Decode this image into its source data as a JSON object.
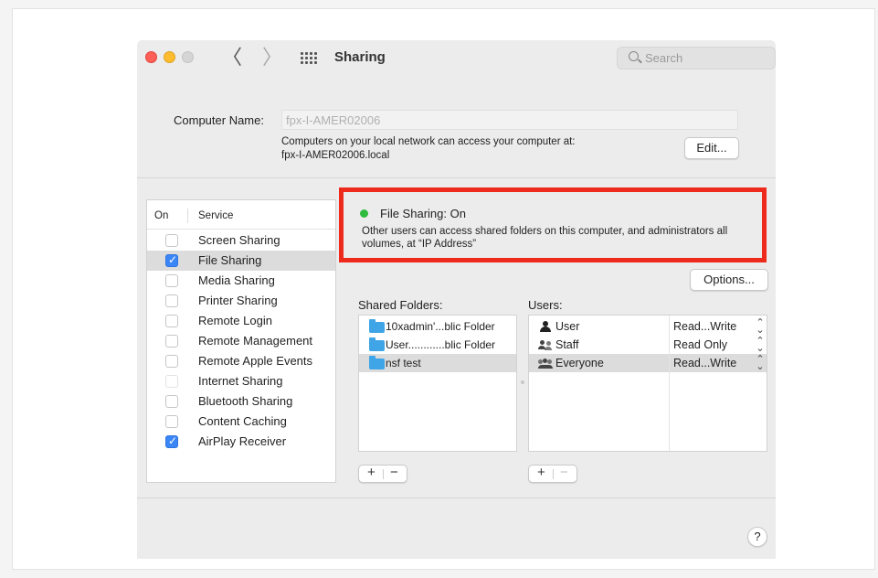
{
  "window": {
    "title": "Sharing",
    "back_label": "〈",
    "forward_label": "〉",
    "search_placeholder": "Search"
  },
  "computer_name": {
    "label": "Computer Name:",
    "value": "fpx-I-AMER02006",
    "info_line1": "Computers on your local network can access your computer at:",
    "info_line2": "fpx-I-AMER02006.local",
    "edit_label": "Edit..."
  },
  "services": {
    "header_on": "On",
    "header_service": "Service",
    "items": [
      {
        "label": "Screen Sharing",
        "checked": false
      },
      {
        "label": "File Sharing",
        "checked": true,
        "selected": true
      },
      {
        "label": "Media Sharing",
        "checked": false
      },
      {
        "label": "Printer Sharing",
        "checked": false
      },
      {
        "label": "Remote Login",
        "checked": false
      },
      {
        "label": "Remote Management",
        "checked": false
      },
      {
        "label": "Remote Apple Events",
        "checked": false
      },
      {
        "label": "Internet Sharing",
        "checked": false,
        "disabled": true
      },
      {
        "label": "Bluetooth Sharing",
        "checked": false
      },
      {
        "label": "Content Caching",
        "checked": false
      },
      {
        "label": "AirPlay Receiver",
        "checked": true
      }
    ]
  },
  "status": {
    "title": "File Sharing: On",
    "color": "#2fbb3e",
    "description": "Other users can access shared folders on this computer, and administrators all volumes, at “IP Address”",
    "highlight_color": "#ee2a1c"
  },
  "options_label": "Options...",
  "shared_folders": {
    "label": "Shared Folders:",
    "items": [
      {
        "name": "10xadmin'...blic Folder"
      },
      {
        "name": "User............blic Folder"
      },
      {
        "name": "nsf test",
        "selected": true
      }
    ]
  },
  "users": {
    "label": "Users:",
    "items": [
      {
        "name": "User",
        "permission": "Read...Write",
        "icon": "user-icon"
      },
      {
        "name": "Staff",
        "permission": "Read Only",
        "icon": "group-icon"
      },
      {
        "name": "Everyone",
        "permission": "Read...Write",
        "icon": "everyone-icon",
        "selected": true
      }
    ]
  },
  "buttons": {
    "plus": "+",
    "minus": "−",
    "help": "?"
  }
}
